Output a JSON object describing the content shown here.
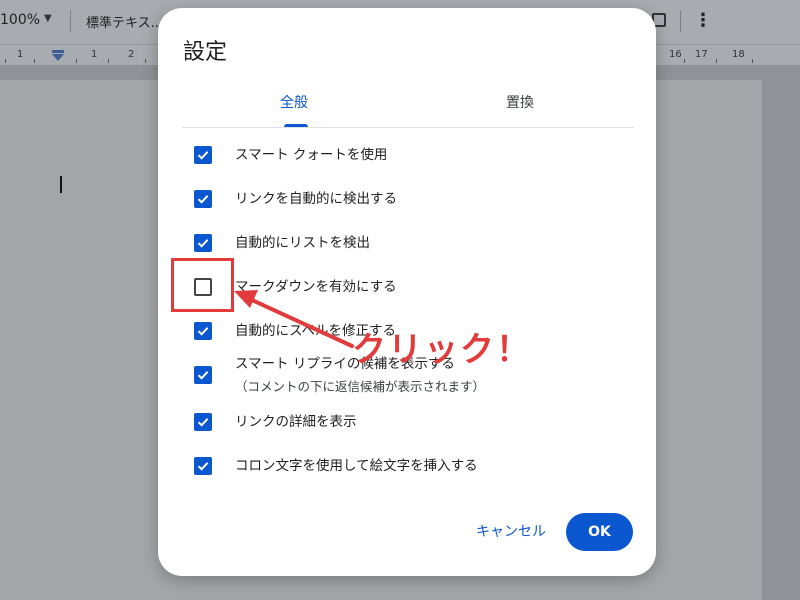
{
  "toolbar": {
    "zoom": "100%",
    "style_dropdown": "標準テキス...",
    "icons": [
      "image-icon",
      "more-vert-icon"
    ]
  },
  "ruler": {
    "numbers": [
      "1",
      "1",
      "2",
      "16",
      "17",
      "18"
    ]
  },
  "dialog": {
    "title": "設定",
    "tabs": [
      {
        "label": "全般",
        "selected": true
      },
      {
        "label": "置換",
        "selected": false
      }
    ],
    "options": [
      {
        "label": "スマート クォートを使用",
        "checked": true
      },
      {
        "label": "リンクを自動的に検出する",
        "checked": true
      },
      {
        "label": "自動的にリストを検出",
        "checked": true
      },
      {
        "label": "マークダウンを有効にする",
        "checked": false
      },
      {
        "label": "自動的にスペルを修正する",
        "checked": true
      },
      {
        "label": "スマート リプライの候補を表示する",
        "sublabel": "（コメントの下に返信候補が表示されます）",
        "checked": true
      },
      {
        "label": "リンクの詳細を表示",
        "checked": true
      },
      {
        "label": "コロン文字を使用して絵文字を挿入する",
        "checked": true
      }
    ],
    "cancel_label": "キャンセル",
    "ok_label": "OK"
  },
  "annotation": {
    "text": "クリック！",
    "color": "#e23b3b"
  },
  "colors": {
    "accent": "#0b57d0",
    "annotation": "#e23b3b"
  }
}
